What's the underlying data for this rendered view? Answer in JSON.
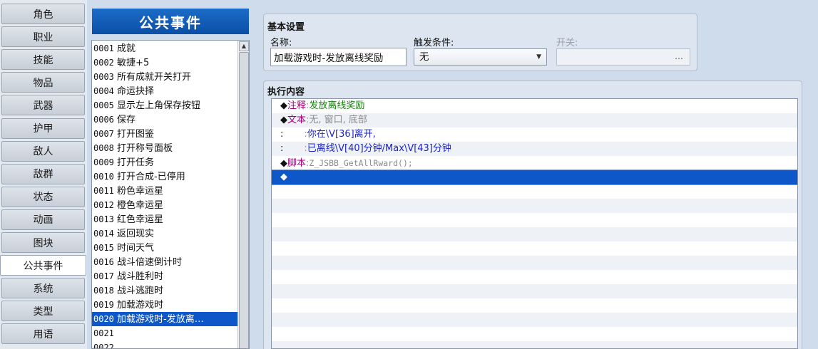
{
  "tabs": [
    {
      "label": "角色"
    },
    {
      "label": "职业"
    },
    {
      "label": "技能"
    },
    {
      "label": "物品"
    },
    {
      "label": "武器"
    },
    {
      "label": "护甲"
    },
    {
      "label": "敌人"
    },
    {
      "label": "敌群"
    },
    {
      "label": "状态"
    },
    {
      "label": "动画"
    },
    {
      "label": "图块"
    },
    {
      "label": "公共事件"
    },
    {
      "label": "系统"
    },
    {
      "label": "类型"
    },
    {
      "label": "用语"
    }
  ],
  "active_tab": "公共事件",
  "event_list": {
    "title": "公共事件",
    "selected_id": "0020",
    "items": [
      {
        "id": "0001",
        "name": "成就"
      },
      {
        "id": "0002",
        "name": "敏捷+5"
      },
      {
        "id": "0003",
        "name": "所有成就开关打开"
      },
      {
        "id": "0004",
        "name": "命运抉择"
      },
      {
        "id": "0005",
        "name": "显示左上角保存按钮"
      },
      {
        "id": "0006",
        "name": "保存"
      },
      {
        "id": "0007",
        "name": "打开图鉴"
      },
      {
        "id": "0008",
        "name": "打开称号面板"
      },
      {
        "id": "0009",
        "name": "打开任务"
      },
      {
        "id": "0010",
        "name": "打开合成-已停用"
      },
      {
        "id": "0011",
        "name": "粉色幸运星"
      },
      {
        "id": "0012",
        "name": "橙色幸运星"
      },
      {
        "id": "0013",
        "name": "红色幸运星"
      },
      {
        "id": "0014",
        "name": "返回现实"
      },
      {
        "id": "0015",
        "name": "时间天气"
      },
      {
        "id": "0016",
        "name": "战斗倍速倒计时"
      },
      {
        "id": "0017",
        "name": "战斗胜利时"
      },
      {
        "id": "0018",
        "name": "战斗逃跑时"
      },
      {
        "id": "0019",
        "name": "加载游戏时"
      },
      {
        "id": "0020",
        "name": "加载游戏时-发放离…"
      },
      {
        "id": "0021",
        "name": ""
      },
      {
        "id": "0022",
        "name": ""
      }
    ]
  },
  "basic_settings": {
    "title": "基本设置",
    "name_label": "名称:",
    "name_value": "加载游戏时-发放离线奖励",
    "trigger_label": "触发条件:",
    "trigger_value": "无",
    "switch_label": "开关:",
    "switch_button": "…"
  },
  "execution": {
    "title": "执行内容",
    "lines": [
      {
        "marker": "◆",
        "command": "注释",
        "colon": ":",
        "text": "发放离线奖励",
        "tone": "green"
      },
      {
        "marker": "◆",
        "command": "文本",
        "colon": ":",
        "text": "无, 窗口, 底部",
        "tone": "gray"
      },
      {
        "marker": ":",
        "command": "",
        "colon": ":",
        "text": "你在\\V[36]离开,",
        "tone": "blue"
      },
      {
        "marker": ":",
        "command": "",
        "colon": ":",
        "text": "已离线\\V[40]分钟/Max\\V[43]分钟",
        "tone": "blue"
      },
      {
        "marker": "◆",
        "command": "脚本",
        "colon": ":",
        "text": "Z_JSBB_GetAllRward();",
        "tone": "mono"
      },
      {
        "marker": "◆",
        "command": "",
        "colon": "",
        "text": "",
        "tone": "selected"
      }
    ],
    "empty_rows": 12
  }
}
